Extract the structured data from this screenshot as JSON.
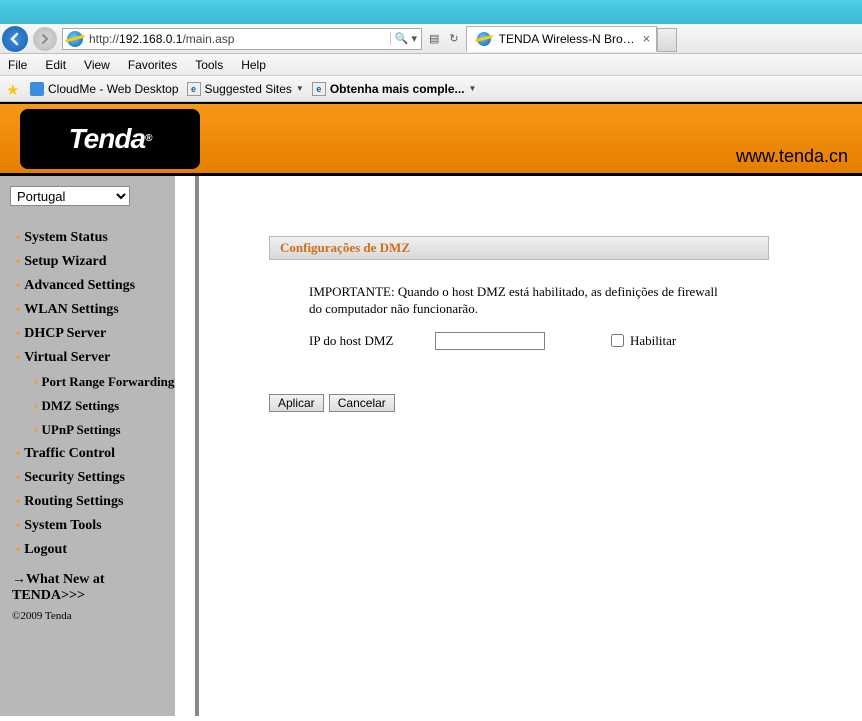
{
  "browser": {
    "url_prefix": "http://",
    "url_host": "192.168.0.1",
    "url_path": "/main.asp",
    "tab_title": "TENDA Wireless-N Broadba...",
    "menu": {
      "file": "File",
      "edit": "Edit",
      "view": "View",
      "favorites": "Favorites",
      "tools": "Tools",
      "help": "Help"
    },
    "favbar": {
      "item1": "CloudMe - Web Desktop",
      "item2": "Suggested Sites",
      "item3": "Obtenha mais comple..."
    }
  },
  "banner": {
    "logo_text": "Tenda",
    "site_url": "www.tenda.cn"
  },
  "sidebar": {
    "language_selected": "Portugal",
    "items": {
      "system_status": "System Status",
      "setup_wizard": "Setup Wizard",
      "advanced_settings": "Advanced Settings",
      "wlan_settings": "WLAN Settings",
      "dhcp_server": "DHCP Server",
      "virtual_server": "Virtual Server",
      "port_range_forwarding": "Port Range Forwarding",
      "dmz_settings": "DMZ Settings",
      "upnp_settings": "UPnP Settings",
      "traffic_control": "Traffic Control",
      "security_settings": "Security Settings",
      "routing_settings": "Routing Settings",
      "system_tools": "System Tools",
      "logout": "Logout"
    },
    "whatsnew": "→What New at TENDA>>>",
    "copyright": "©2009 Tenda"
  },
  "content": {
    "panel_title": "Configurações de DMZ",
    "warning": "IMPORTANTE: Quando o host DMZ está habilitado, as definições de firewall do computador não funcionarão.",
    "ip_label": "IP do host DMZ",
    "ip_value": "",
    "enable_label": "Habilitar",
    "btn_apply": "Aplicar",
    "btn_cancel": "Cancelar"
  }
}
